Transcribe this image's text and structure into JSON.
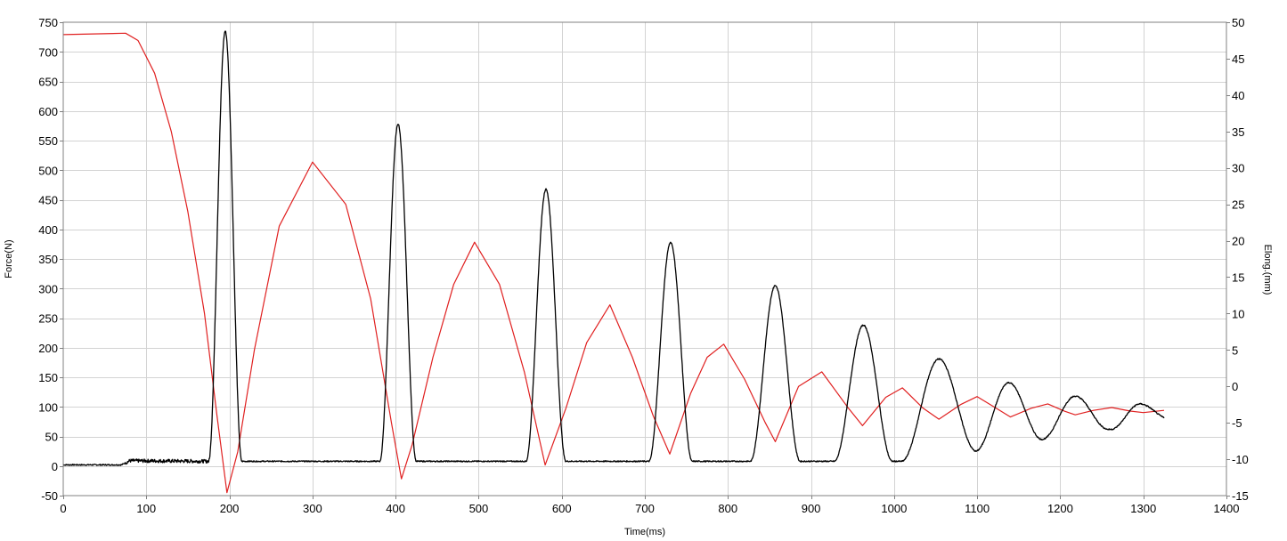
{
  "chart_data": {
    "type": "line",
    "title": "",
    "xlabel": "Time(ms)",
    "ylabel": "Force(N)",
    "y2label": "Elong.(mm)",
    "xlim": [
      0,
      1400
    ],
    "ylim": [
      -50,
      750
    ],
    "y2lim": [
      -15,
      50
    ],
    "grid": true,
    "legend": "none",
    "x_ticks": [
      0,
      100,
      200,
      300,
      400,
      500,
      600,
      700,
      800,
      900,
      1000,
      1100,
      1200,
      1300,
      1400
    ],
    "y_ticks": [
      -50,
      0,
      50,
      100,
      150,
      200,
      250,
      300,
      350,
      400,
      450,
      500,
      550,
      600,
      650,
      700,
      750
    ],
    "y2_ticks": [
      -15,
      -10,
      -5,
      0,
      5,
      10,
      15,
      20,
      25,
      30,
      35,
      40,
      45,
      50
    ],
    "series": [
      {
        "axis": "left",
        "color": "#000000",
        "baseline": [
          [
            0,
            2
          ],
          [
            70,
            2
          ],
          [
            80,
            9
          ],
          [
            180,
            8
          ],
          [
            215,
            8
          ],
          [
            380,
            8
          ],
          [
            425,
            8
          ],
          [
            560,
            8
          ],
          [
            635,
            8
          ],
          [
            705,
            8
          ],
          [
            760,
            8
          ],
          [
            820,
            8
          ],
          [
            845,
            8
          ]
        ],
        "peaks": [
          {
            "t": 195,
            "half_width": 20,
            "peak": 735,
            "base_left": 8,
            "base_right": 8
          },
          {
            "t": 403,
            "half_width": 22,
            "peak": 578,
            "base_left": 8,
            "base_right": 8
          },
          {
            "t": 581,
            "half_width": 24,
            "peak": 468,
            "base_left": 8,
            "base_right": 8
          },
          {
            "t": 731,
            "half_width": 26,
            "peak": 378,
            "base_left": 8,
            "base_right": 8
          },
          {
            "t": 857,
            "half_width": 30,
            "peak": 305,
            "base_left": 8,
            "base_right": 8
          },
          {
            "t": 963,
            "half_width": 35,
            "peak": 238,
            "base_left": 8,
            "base_right": 8
          },
          {
            "t": 1054,
            "half_width": 45,
            "peak": 181,
            "base_left": 8,
            "base_right": 25
          },
          {
            "t": 1138,
            "half_width": 40,
            "peak": 141,
            "base_left": 25,
            "base_right": 45
          },
          {
            "t": 1218,
            "half_width": 40,
            "peak": 118,
            "base_left": 45,
            "base_right": 62
          },
          {
            "t": 1296,
            "half_width": 35,
            "peak": 105,
            "base_left": 62,
            "base_right": 80
          }
        ]
      },
      {
        "axis": "right",
        "color": "#e02020",
        "points": [
          [
            0,
            48.3
          ],
          [
            75,
            48.5
          ],
          [
            90,
            47.5
          ],
          [
            110,
            43
          ],
          [
            130,
            35
          ],
          [
            150,
            24
          ],
          [
            170,
            10
          ],
          [
            185,
            -4
          ],
          [
            197,
            -14.6
          ],
          [
            210,
            -9
          ],
          [
            230,
            5
          ],
          [
            260,
            22
          ],
          [
            300,
            30.8
          ],
          [
            340,
            25
          ],
          [
            370,
            12
          ],
          [
            395,
            -5
          ],
          [
            407,
            -12.7
          ],
          [
            420,
            -8
          ],
          [
            445,
            4
          ],
          [
            470,
            14
          ],
          [
            495,
            19.8
          ],
          [
            525,
            14
          ],
          [
            555,
            2
          ],
          [
            580,
            -10.8
          ],
          [
            605,
            -3
          ],
          [
            630,
            6
          ],
          [
            658,
            11.2
          ],
          [
            685,
            4
          ],
          [
            710,
            -4
          ],
          [
            730,
            -9.3
          ],
          [
            755,
            -1
          ],
          [
            775,
            4
          ],
          [
            795,
            5.8
          ],
          [
            820,
            1
          ],
          [
            845,
            -5
          ],
          [
            857,
            -7.6
          ],
          [
            885,
            0
          ],
          [
            913,
            2
          ],
          [
            945,
            -3
          ],
          [
            962,
            -5.4
          ],
          [
            990,
            -1.5
          ],
          [
            1010,
            -0.2
          ],
          [
            1035,
            -3
          ],
          [
            1054,
            -4.5
          ],
          [
            1080,
            -2.5
          ],
          [
            1100,
            -1.4
          ],
          [
            1120,
            -2.8
          ],
          [
            1140,
            -4.2
          ],
          [
            1165,
            -3
          ],
          [
            1185,
            -2.4
          ],
          [
            1205,
            -3.4
          ],
          [
            1218,
            -3.9
          ],
          [
            1240,
            -3.3
          ],
          [
            1262,
            -2.9
          ],
          [
            1285,
            -3.4
          ],
          [
            1300,
            -3.6
          ],
          [
            1325,
            -3.3
          ]
        ]
      }
    ]
  }
}
